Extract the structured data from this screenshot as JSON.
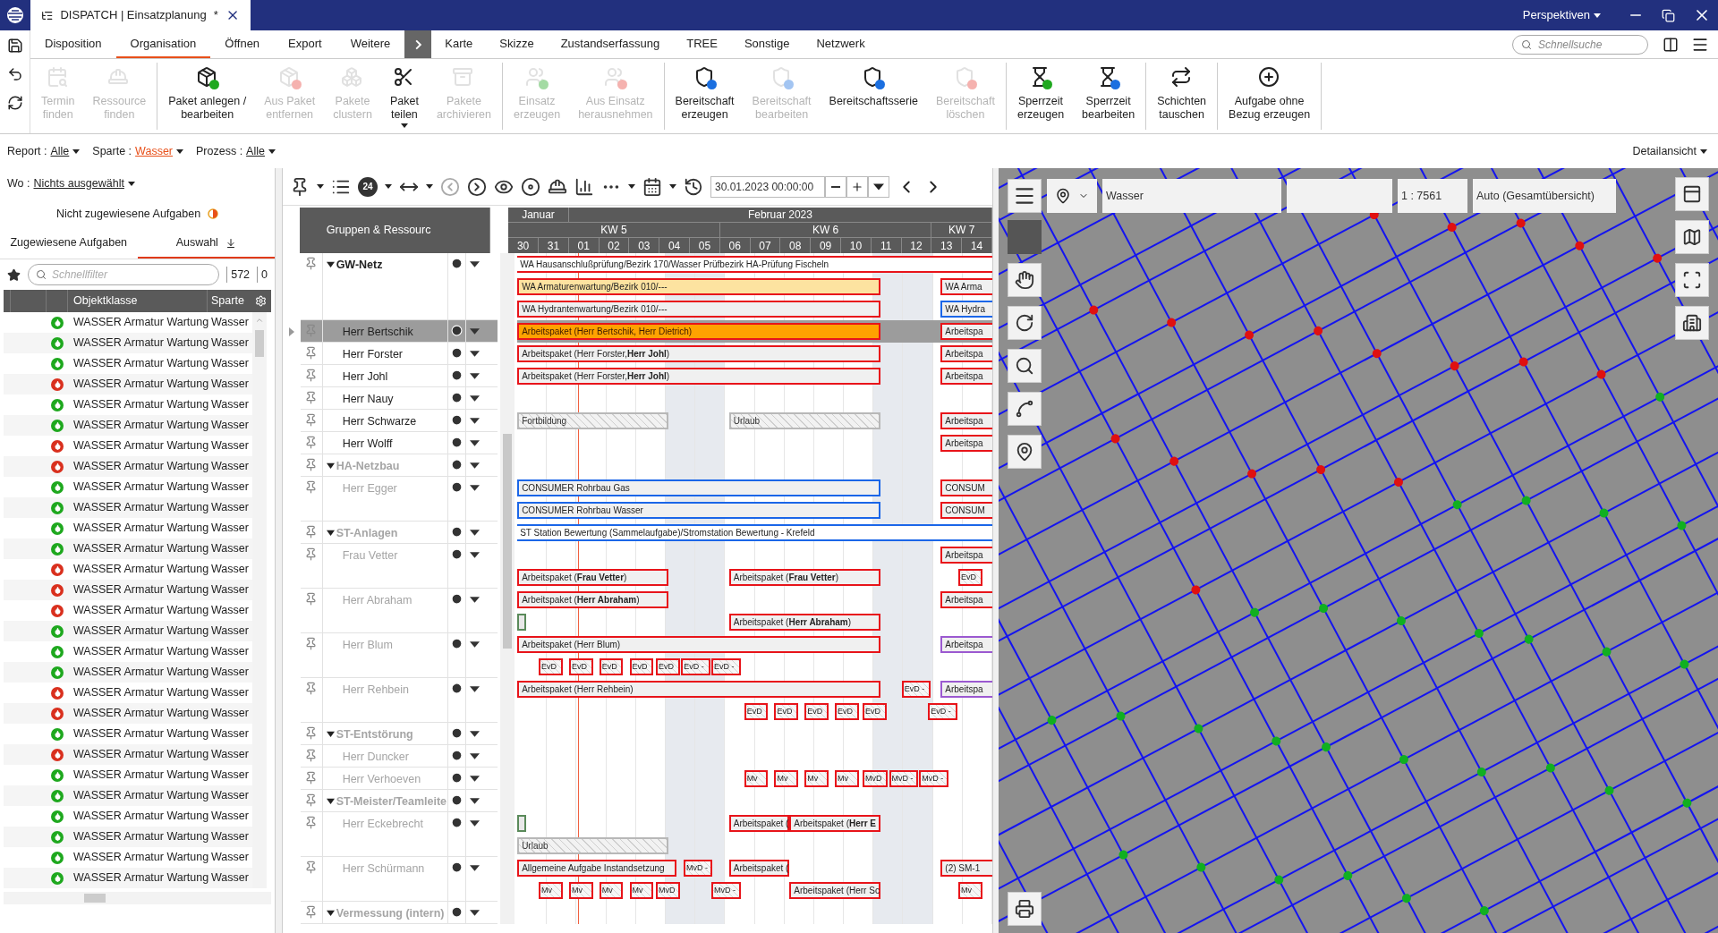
{
  "title_bar": {
    "tab_title": "DISPATCH | Einsatzplanung",
    "modified_mark": "*",
    "perspectives": "Perspektiven"
  },
  "menu_tabs": [
    {
      "label": "Disposition",
      "selected": false
    },
    {
      "label": "Organisation",
      "selected": true
    },
    {
      "label": "Öffnen",
      "selected": false
    },
    {
      "label": "Export",
      "selected": false
    },
    {
      "label": "Weitere",
      "selected": false
    }
  ],
  "extra_tabs": [
    {
      "label": "Karte",
      "selected": false
    },
    {
      "label": "Skizze",
      "selected": false
    },
    {
      "label": "Zustandserfassung",
      "selected": false
    },
    {
      "label": "TREE",
      "selected": false
    },
    {
      "label": "Sonstige",
      "selected": false
    },
    {
      "label": "Netzwerk",
      "selected": false
    }
  ],
  "quick_search": {
    "placeholder": "Schnellsuche"
  },
  "ribbon": [
    {
      "items": [
        {
          "lines": [
            "Termin",
            "finden"
          ],
          "disabled": true,
          "menu": false
        },
        {
          "lines": [
            "Ressource",
            "finden"
          ],
          "disabled": true,
          "menu": false
        }
      ]
    },
    {
      "items": [
        {
          "lines": [
            "Paket anlegen /",
            "bearbeiten"
          ],
          "disabled": false,
          "menu": false
        },
        {
          "lines": [
            "Aus Paket",
            "entfernen"
          ],
          "disabled": true,
          "menu": false
        },
        {
          "lines": [
            "Pakete",
            "clustern"
          ],
          "disabled": true,
          "menu": false
        },
        {
          "lines": [
            "Paket",
            "teilen"
          ],
          "disabled": false,
          "menu": true
        },
        {
          "lines": [
            "Pakete",
            "archivieren"
          ],
          "disabled": true,
          "menu": false
        }
      ]
    },
    {
      "items": [
        {
          "lines": [
            "Einsatz",
            "erzeugen"
          ],
          "disabled": true,
          "menu": false
        },
        {
          "lines": [
            "Aus Einsatz",
            "herausnehmen"
          ],
          "disabled": true,
          "menu": false
        }
      ]
    },
    {
      "items": [
        {
          "lines": [
            "Bereitschaft",
            "erzeugen"
          ],
          "disabled": false,
          "menu": false
        },
        {
          "lines": [
            "Bereitschaft",
            "bearbeiten"
          ],
          "disabled": true,
          "menu": false
        },
        {
          "lines": [
            "Bereitschaftsserie"
          ],
          "disabled": false,
          "menu": false
        },
        {
          "lines": [
            "Bereitschaft",
            "löschen"
          ],
          "disabled": true,
          "menu": false
        }
      ]
    },
    {
      "items": [
        {
          "lines": [
            "Sperrzeit",
            "erzeugen"
          ],
          "disabled": false,
          "menu": false
        },
        {
          "lines": [
            "Sperrzeit",
            "bearbeiten"
          ],
          "disabled": false,
          "menu": false
        }
      ]
    },
    {
      "items": [
        {
          "lines": [
            "Schichten",
            "tauschen"
          ],
          "disabled": false,
          "menu": false
        }
      ]
    },
    {
      "items": [
        {
          "lines": [
            "Aufgabe ohne",
            "Bezug erzeugen"
          ],
          "disabled": false,
          "menu": false
        }
      ]
    }
  ],
  "filters": [
    {
      "label": "Report :",
      "value": "Alle",
      "highlighted": false
    },
    {
      "label": "Sparte :",
      "value": "Wasser",
      "highlighted": true
    },
    {
      "label": "Prozess :",
      "value": "Alle",
      "highlighted": false
    }
  ],
  "detail_view": "Detailansicht",
  "left_panel": {
    "where_label": "Wo :",
    "where_value": "Nichts ausgewählt",
    "unassigned": "Nicht zugewiesene Aufgaben",
    "tabs": [
      {
        "label": "Zugewiesene Aufgaben",
        "selected": false
      },
      {
        "label": "Auswahl",
        "selected": true
      }
    ],
    "filter_placeholder": "Schnellfilter",
    "count": "572",
    "count_2": "0",
    "columns": [
      "Objektklasse",
      "Sparte"
    ],
    "rows": [
      {
        "color": "#1ea81e",
        "objektklasse": "WASSER Armatur Wartung",
        "sparte": "Wasser"
      },
      {
        "color": "#1ea81e",
        "objektklasse": "WASSER Armatur Wartung",
        "sparte": "Wasser"
      },
      {
        "color": "#1ea81e",
        "objektklasse": "WASSER Armatur Wartung",
        "sparte": "Wasser"
      },
      {
        "color": "#d9301e",
        "objektklasse": "WASSER Armatur Wartung",
        "sparte": "Wasser"
      },
      {
        "color": "#1ea81e",
        "objektklasse": "WASSER Armatur Wartung",
        "sparte": "Wasser"
      },
      {
        "color": "#1ea81e",
        "objektklasse": "WASSER Armatur Wartung",
        "sparte": "Wasser"
      },
      {
        "color": "#d9301e",
        "objektklasse": "WASSER Armatur Wartung",
        "sparte": "Wasser"
      },
      {
        "color": "#d9301e",
        "objektklasse": "WASSER Armatur Wartung",
        "sparte": "Wasser"
      },
      {
        "color": "#1ea81e",
        "objektklasse": "WASSER Armatur Wartung",
        "sparte": "Wasser"
      },
      {
        "color": "#1ea81e",
        "objektklasse": "WASSER Armatur Wartung",
        "sparte": "Wasser"
      },
      {
        "color": "#1ea81e",
        "objektklasse": "WASSER Armatur Wartung",
        "sparte": "Wasser"
      },
      {
        "color": "#1ea81e",
        "objektklasse": "WASSER Armatur Wartung",
        "sparte": "Wasser"
      },
      {
        "color": "#d9301e",
        "objektklasse": "WASSER Armatur Wartung",
        "sparte": "Wasser"
      },
      {
        "color": "#d9301e",
        "objektklasse": "WASSER Armatur Wartung",
        "sparte": "Wasser"
      },
      {
        "color": "#d9301e",
        "objektklasse": "WASSER Armatur Wartung",
        "sparte": "Wasser"
      },
      {
        "color": "#1ea81e",
        "objektklasse": "WASSER Armatur Wartung",
        "sparte": "Wasser"
      },
      {
        "color": "#1ea81e",
        "objektklasse": "WASSER Armatur Wartung",
        "sparte": "Wasser"
      },
      {
        "color": "#1ea81e",
        "objektklasse": "WASSER Armatur Wartung",
        "sparte": "Wasser"
      },
      {
        "color": "#d9301e",
        "objektklasse": "WASSER Armatur Wartung",
        "sparte": "Wasser"
      },
      {
        "color": "#d9301e",
        "objektklasse": "WASSER Armatur Wartung",
        "sparte": "Wasser"
      },
      {
        "color": "#1ea81e",
        "objektklasse": "WASSER Armatur Wartung",
        "sparte": "Wasser"
      },
      {
        "color": "#d9301e",
        "objektklasse": "WASSER Armatur Wartung",
        "sparte": "Wasser"
      },
      {
        "color": "#1ea81e",
        "objektklasse": "WASSER Armatur Wartung",
        "sparte": "Wasser"
      },
      {
        "color": "#1ea81e",
        "objektklasse": "WASSER Armatur Wartung",
        "sparte": "Wasser"
      },
      {
        "color": "#1ea81e",
        "objektklasse": "WASSER Armatur Wartung",
        "sparte": "Wasser"
      },
      {
        "color": "#1ea81e",
        "objektklasse": "WASSER Armatur Wartung",
        "sparte": "Wasser"
      },
      {
        "color": "#1ea81e",
        "objektklasse": "WASSER Armatur Wartung",
        "sparte": "Wasser"
      },
      {
        "color": "#1ea81e",
        "objektklasse": "WASSER Armatur Wartung",
        "sparte": "Wasser"
      }
    ]
  },
  "gantt": {
    "range_badge": "24",
    "date": "30.01.2023 00:00:00",
    "resource_header": "Gruppen & Ressourc",
    "months": [
      {
        "label": "Januar"
      },
      {
        "label": "Februar 2023"
      }
    ],
    "weeks": [
      {
        "label": "KW 5"
      },
      {
        "label": "KW 6"
      },
      {
        "label": "KW 7"
      }
    ],
    "days": [
      {
        "label": "30",
        "weekend": false
      },
      {
        "label": "31",
        "weekend": false
      },
      {
        "label": "01",
        "weekend": false
      },
      {
        "label": "02",
        "weekend": false
      },
      {
        "label": "03",
        "weekend": false
      },
      {
        "label": "04",
        "weekend": true
      },
      {
        "label": "05",
        "weekend": true
      },
      {
        "label": "06",
        "weekend": false
      },
      {
        "label": "07",
        "weekend": false
      },
      {
        "label": "08",
        "weekend": false
      },
      {
        "label": "09",
        "weekend": false
      },
      {
        "label": "10",
        "weekend": false
      },
      {
        "label": "11",
        "weekend": true
      },
      {
        "label": "12",
        "weekend": true
      },
      {
        "label": "13",
        "weekend": false
      },
      {
        "label": "14",
        "weekend": false
      }
    ],
    "resources": [
      {
        "name": "GW-Netz",
        "kind": "group",
        "expanded": true,
        "dimmed": false,
        "selected": false,
        "lanes": [
          [
            {
              "label": "WA Hausanschlußprüfung/Bezirk 170/Wasser Prüfbezirk HA-Prüfung Fischeln",
              "kind": "span"
            }
          ],
          [
            {
              "label": "WA Armaturenwartung/Bezirk 010/---",
              "kind": "planned"
            },
            {
              "label": "WA Arma",
              "kind": "task"
            }
          ],
          [
            {
              "label": "WA Hydrantenwartung/Bezirk 010/---",
              "kind": "task"
            },
            {
              "label": "WA Hydra",
              "kind": "consumer"
            }
          ]
        ],
        "children": [
          {
            "name": "Herr Bertschik",
            "kind": "person",
            "dimmed": false,
            "selected": true,
            "lanes": [
              [
                {
                  "label": "Arbeitspaket (Herr Bertschik, Herr Dietrich)",
                  "kind": "active"
                },
                {
                  "label": "Arbeitspa",
                  "kind": "task"
                }
              ]
            ]
          },
          {
            "name": "Herr Forster",
            "kind": "person",
            "dimmed": false,
            "selected": false,
            "lanes": [
              [
                {
                  "label": "Arbeitspaket (Herr Forster,**Herr Johl**)",
                  "kind": "task"
                },
                {
                  "label": "Arbeitspa",
                  "kind": "task"
                }
              ]
            ]
          },
          {
            "name": "Herr Johl",
            "kind": "person",
            "dimmed": false,
            "selected": false,
            "lanes": [
              [
                {
                  "label": "Arbeitspaket (Herr Forster,**Herr Johl**)",
                  "kind": "task"
                },
                {
                  "label": "Arbeitspa",
                  "kind": "task"
                }
              ]
            ]
          },
          {
            "name": "Herr Nauy",
            "kind": "person",
            "dimmed": false,
            "selected": false
          },
          {
            "name": "Herr Schwarze",
            "kind": "person",
            "dimmed": false,
            "selected": false,
            "lanes": [
              [
                {
                  "label": "Fortbildung",
                  "kind": "absence"
                },
                {
                  "label": "Urlaub",
                  "kind": "absence"
                },
                {
                  "label": "Arbeitspa",
                  "kind": "task"
                }
              ]
            ]
          },
          {
            "name": "Herr Wolff",
            "kind": "person",
            "dimmed": false,
            "selected": false,
            "lanes": [
              [
                {
                  "label": "Arbeitspa",
                  "kind": "task"
                }
              ]
            ]
          }
        ]
      },
      {
        "name": "HA-Netzbau",
        "kind": "group",
        "expanded": true,
        "dimmed": true,
        "selected": false,
        "children": [
          {
            "name": "Herr Egger",
            "kind": "person",
            "dimmed": true,
            "selected": false,
            "lanes": [
              [
                {
                  "label": "CONSUMER Rohrbau Gas",
                  "kind": "consumer"
                },
                {
                  "label": "CONSUM",
                  "kind": "task"
                }
              ],
              [
                {
                  "label": "CONSUMER Rohrbau Wasser",
                  "kind": "consumer"
                },
                {
                  "label": "CONSUM",
                  "kind": "task"
                }
              ]
            ]
          }
        ]
      },
      {
        "name": "ST-Anlagen",
        "kind": "group",
        "expanded": true,
        "dimmed": true,
        "selected": false,
        "lanes": [
          [
            {
              "label": "ST Station Bewertung (Sammelaufgabe)/Stromstation Bewertung - Krefeld",
              "kind": "span_blue"
            }
          ]
        ],
        "children": [
          {
            "name": "Frau Vetter",
            "kind": "person",
            "dimmed": true,
            "selected": false,
            "lanes": [
              [
                {
                  "label": "Arbeitspa",
                  "kind": "task"
                }
              ],
              [
                {
                  "label": "Arbeitspaket (**Frau Vetter**)",
                  "kind": "task"
                },
                {
                  "label": "Arbeitspaket (**Frau Vetter**)",
                  "kind": "task"
                },
                {
                  "label": "EvD",
                  "kind": "duty"
                }
              ]
            ]
          },
          {
            "name": "Herr Abraham",
            "kind": "person",
            "dimmed": true,
            "selected": false,
            "lanes": [
              [
                {
                  "label": "Arbeitspaket (**Herr Abraham**)",
                  "kind": "task"
                },
                {
                  "label": "Arbeitspa",
                  "kind": "task"
                }
              ],
              [
                {
                  "kind": "marker"
                },
                {
                  "label": "Arbeitspaket (**Herr Abraham**)",
                  "kind": "task"
                }
              ]
            ]
          },
          {
            "name": "Herr Blum",
            "kind": "person",
            "dimmed": true,
            "selected": false,
            "lanes": [
              [
                {
                  "label": "Arbeitspaket (Herr Blum)",
                  "kind": "task"
                },
                {
                  "label": "Arbeitspa",
                  "kind": "other"
                }
              ],
              [
                {
                  "label": "EvD",
                  "kind": "duty"
                },
                {
                  "label": "EvD",
                  "kind": "duty"
                },
                {
                  "label": "EvD",
                  "kind": "duty"
                },
                {
                  "label": "EvD",
                  "kind": "duty"
                },
                {
                  "label": "EvD",
                  "kind": "duty"
                },
                {
                  "label": "EvD -",
                  "kind": "duty"
                },
                {
                  "label": "EvD -",
                  "kind": "duty"
                }
              ]
            ]
          },
          {
            "name": "Herr Rehbein",
            "kind": "person",
            "dimmed": true,
            "selected": false,
            "lanes": [
              [
                {
                  "label": "Arbeitspaket (Herr Rehbein)",
                  "kind": "task"
                },
                {
                  "label": "EvD -",
                  "kind": "duty"
                },
                {
                  "label": "Arbeitspa",
                  "kind": "other"
                }
              ],
              [
                {
                  "label": "EvD",
                  "kind": "duty"
                },
                {
                  "label": "EvD",
                  "kind": "duty"
                },
                {
                  "label": "EvD",
                  "kind": "duty"
                },
                {
                  "label": "EvD",
                  "kind": "duty"
                },
                {
                  "label": "EvD",
                  "kind": "duty"
                },
                {
                  "label": "EvD -",
                  "kind": "duty"
                }
              ]
            ]
          }
        ]
      },
      {
        "name": "ST-Entstörung",
        "kind": "group",
        "expanded": true,
        "dimmed": true,
        "selected": false,
        "children": [
          {
            "name": "Herr Duncker",
            "kind": "person",
            "dimmed": true,
            "selected": false
          },
          {
            "name": "Herr Verhoeven",
            "kind": "person",
            "dimmed": true,
            "selected": false,
            "lanes": [
              [
                {
                  "label": "Mv",
                  "kind": "duty"
                },
                {
                  "label": "Mv",
                  "kind": "duty"
                },
                {
                  "label": "Mv",
                  "kind": "duty"
                },
                {
                  "label": "Mv",
                  "kind": "duty"
                },
                {
                  "label": "MvD",
                  "kind": "duty"
                },
                {
                  "label": "MvD -",
                  "kind": "duty"
                },
                {
                  "label": "MvD -",
                  "kind": "duty"
                }
              ]
            ]
          }
        ]
      },
      {
        "name": "ST-Meister/Teamleite",
        "kind": "group",
        "expanded": true,
        "dimmed": true,
        "selected": false,
        "children": [
          {
            "name": "Herr Eckebrecht",
            "kind": "person",
            "dimmed": true,
            "selected": false,
            "lanes": [
              [
                {
                  "kind": "marker"
                },
                {
                  "label": "Arbeitspaket (",
                  "kind": "task"
                },
                {
                  "label": "Arbeitspaket (**Herr E**",
                  "kind": "task"
                }
              ],
              [
                {
                  "label": "Urlaub",
                  "kind": "absence"
                }
              ]
            ]
          },
          {
            "name": "Herr Schürmann",
            "kind": "person",
            "dimmed": true,
            "selected": false,
            "lanes": [
              [
                {
                  "label": "Allgemeine Aufgabe Instandsetzung",
                  "kind": "task"
                },
                {
                  "label": "MvD -",
                  "kind": "duty"
                },
                {
                  "label": "Arbeitspaket (",
                  "kind": "task"
                },
                {
                  "label": "(2) SM-1",
                  "kind": "task"
                }
              ],
              [
                {
                  "label": "Mv",
                  "kind": "duty"
                },
                {
                  "label": "Mv",
                  "kind": "duty"
                },
                {
                  "label": "Mv",
                  "kind": "duty"
                },
                {
                  "label": "Mv",
                  "kind": "duty"
                },
                {
                  "label": "MvD",
                  "kind": "duty"
                },
                {
                  "label": "MvD -",
                  "kind": "duty"
                },
                {
                  "label": "Arbeitspaket (Herr Sc",
                  "kind": "task"
                },
                {
                  "label": "Mv",
                  "kind": "duty"
                }
              ]
            ]
          }
        ]
      },
      {
        "name": "Vermessung (intern)",
        "kind": "group",
        "expanded": true,
        "dimmed": true,
        "selected": false
      }
    ]
  },
  "map": {
    "layer": "Wasser",
    "scale": "1 : 7561",
    "mode": "Auto (Gesamtübersicht)"
  }
}
